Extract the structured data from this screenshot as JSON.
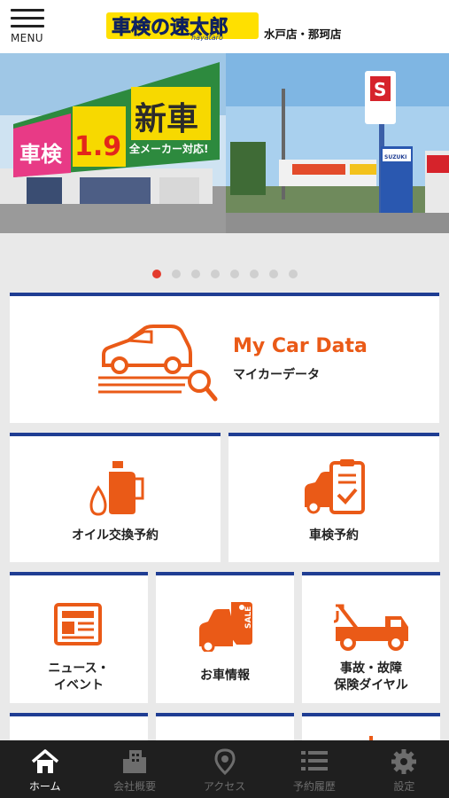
{
  "header": {
    "menu_label": "MENU",
    "logo_text": "車検の速太郎",
    "logo_sub": "hayataro",
    "store_name": "水戸店・那珂店"
  },
  "banner": {
    "sign_left": "車検",
    "sign_price": "1.9",
    "sign_new": "新車",
    "sign_maker": "全メーカー対応!",
    "dealer_logo": "S",
    "dealer_name": "SUZUKI"
  },
  "pager": {
    "count": 8,
    "active_index": 0
  },
  "tiles": {
    "mycar": {
      "title": "My Car Data",
      "subtitle": "マイカーデータ"
    },
    "oil": {
      "label": "オイル交換予約"
    },
    "shaken": {
      "label": "車検予約"
    },
    "news": {
      "line1": "ニュース・",
      "line2": "イベント"
    },
    "cars": {
      "label": "お車情報",
      "tag": "SALE"
    },
    "accident": {
      "line1": "事故・故障",
      "line2": "保険ダイヤル"
    }
  },
  "tabbar": {
    "items": [
      {
        "label": "ホーム",
        "icon": "home-icon",
        "active": true
      },
      {
        "label": "会社概要",
        "icon": "building-icon",
        "active": false
      },
      {
        "label": "アクセス",
        "icon": "map-pin-icon",
        "active": false
      },
      {
        "label": "予約履歴",
        "icon": "list-icon",
        "active": false
      },
      {
        "label": "設定",
        "icon": "gear-icon",
        "active": false
      }
    ]
  },
  "colors": {
    "accent": "#ea5a17",
    "tile_border": "#1f3d93",
    "tabbar_bg": "#1f1f1f",
    "dot_active": "#e33b2d"
  }
}
